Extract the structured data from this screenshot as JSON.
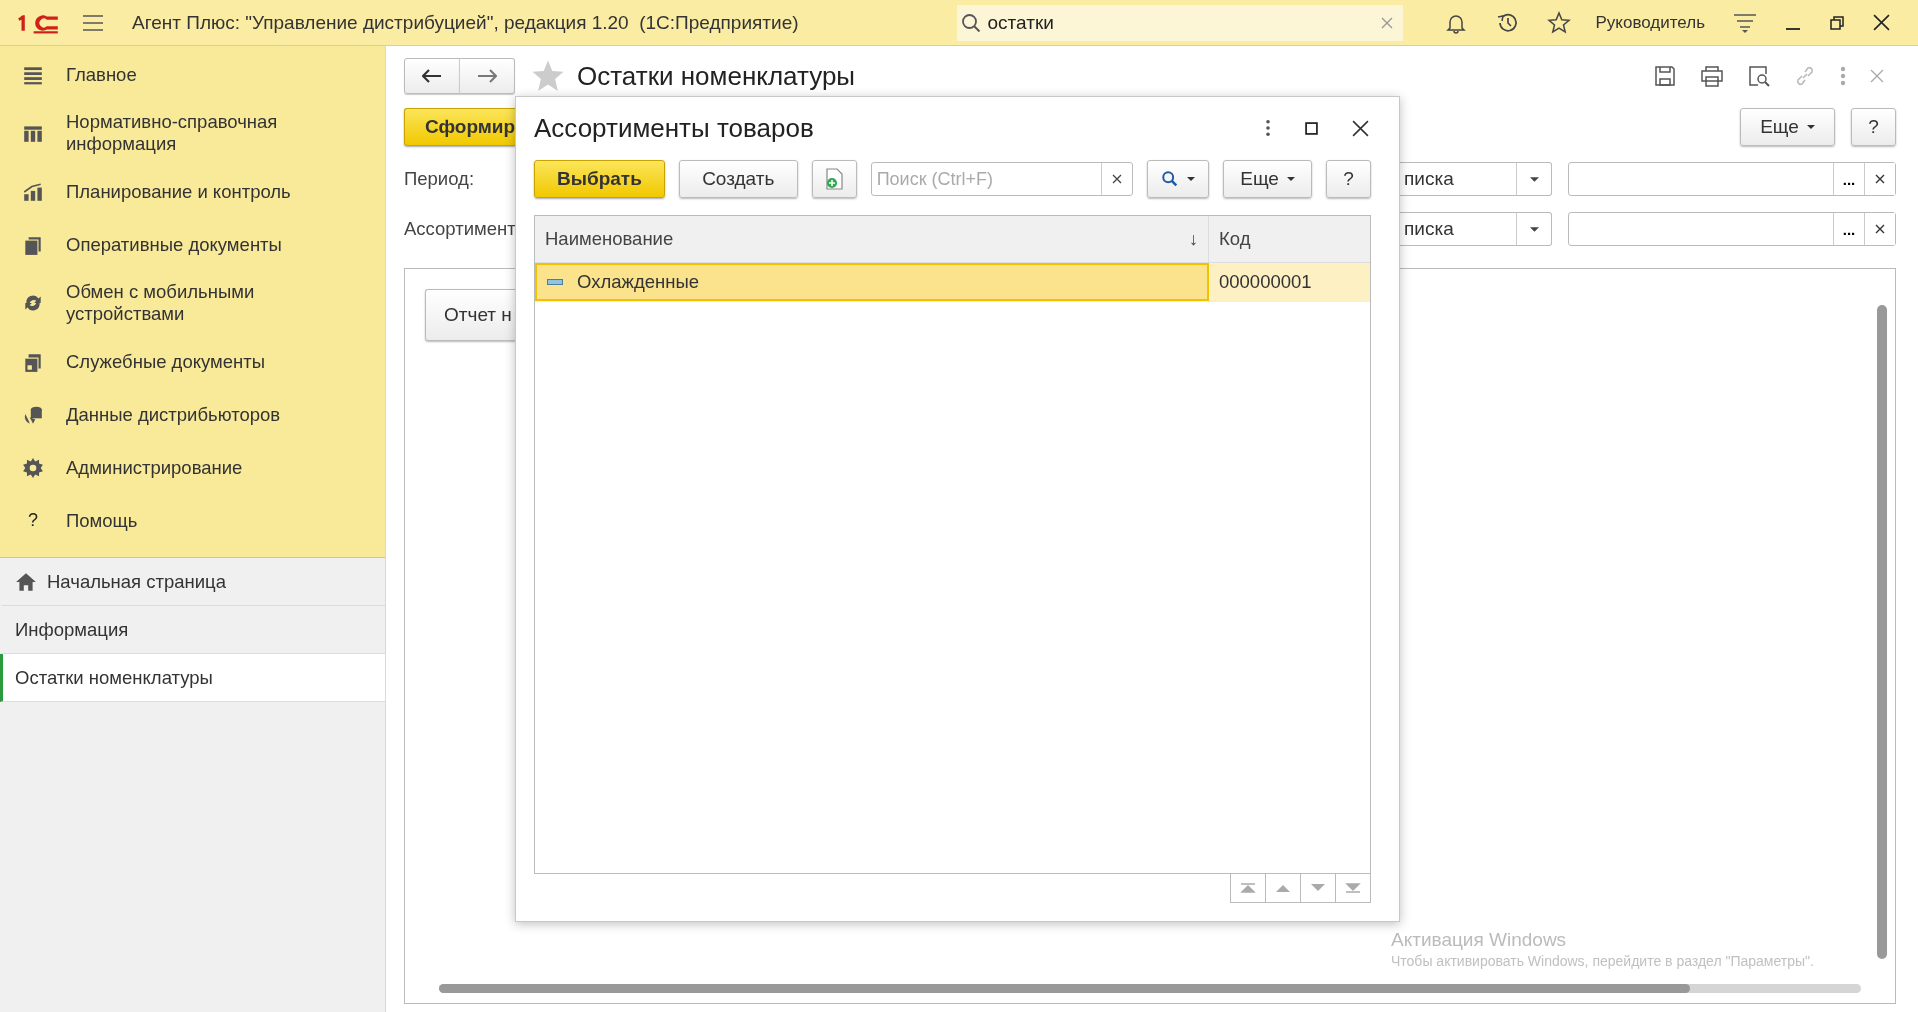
{
  "app": {
    "title": "Агент Плюс: \"Управление дистрибуцией\", редакция 1.20  (1С:Предприятие)",
    "search": {
      "value": "остатки"
    },
    "user": "Руководитель"
  },
  "sidebar": {
    "sections": [
      {
        "label": "Главное",
        "kind": "menu"
      },
      {
        "label": "Нормативно-справочная информация",
        "kind": "catalog"
      },
      {
        "label": "Планирование и контроль",
        "kind": "chart"
      },
      {
        "label": "Оперативные документы",
        "kind": "docs"
      },
      {
        "label": "Обмен с мобильными устройствами",
        "kind": "sync"
      },
      {
        "label": "Служебные документы",
        "kind": "service"
      },
      {
        "label": "Данные дистрибьюторов",
        "kind": "database"
      },
      {
        "label": "Администрирование",
        "kind": "gear"
      },
      {
        "label": "Помощь",
        "kind": "help",
        "glyph": "?"
      }
    ],
    "open_windows": [
      {
        "label": "Начальная страница",
        "kind": "home",
        "selected": false
      },
      {
        "label": "Информация",
        "kind": "plain",
        "selected": false
      },
      {
        "label": "Остатки номенклатуры",
        "kind": "plain",
        "selected": true
      }
    ]
  },
  "form": {
    "title": "Остатки номенклатуры",
    "generate_button": "Сформир",
    "more_button": "Еще",
    "help_button": "?",
    "fields": [
      {
        "label": "Период:",
        "mode": "писка",
        "choose_button": "..."
      },
      {
        "label": "Ассортимент",
        "mode": "писка",
        "choose_button": "..."
      }
    ],
    "report_button": "Отчет н"
  },
  "dialog": {
    "title": "Ассортименты товаров",
    "select_button": "Выбрать",
    "create_button": "Создать",
    "search": {
      "placeholder": "Поиск (Ctrl+F)"
    },
    "more_button": "Еще",
    "help_button": "?",
    "columns": [
      {
        "label": "Наименование",
        "sort_mark": "↓"
      },
      {
        "label": "Код"
      }
    ],
    "rows": [
      {
        "name": "Охлажденные",
        "code": "000000001",
        "selected": true
      }
    ]
  },
  "watermark": {
    "title": "Активация Windows",
    "text": "Чтобы активировать Windows, перейдите в раздел \"Параметры\"."
  }
}
